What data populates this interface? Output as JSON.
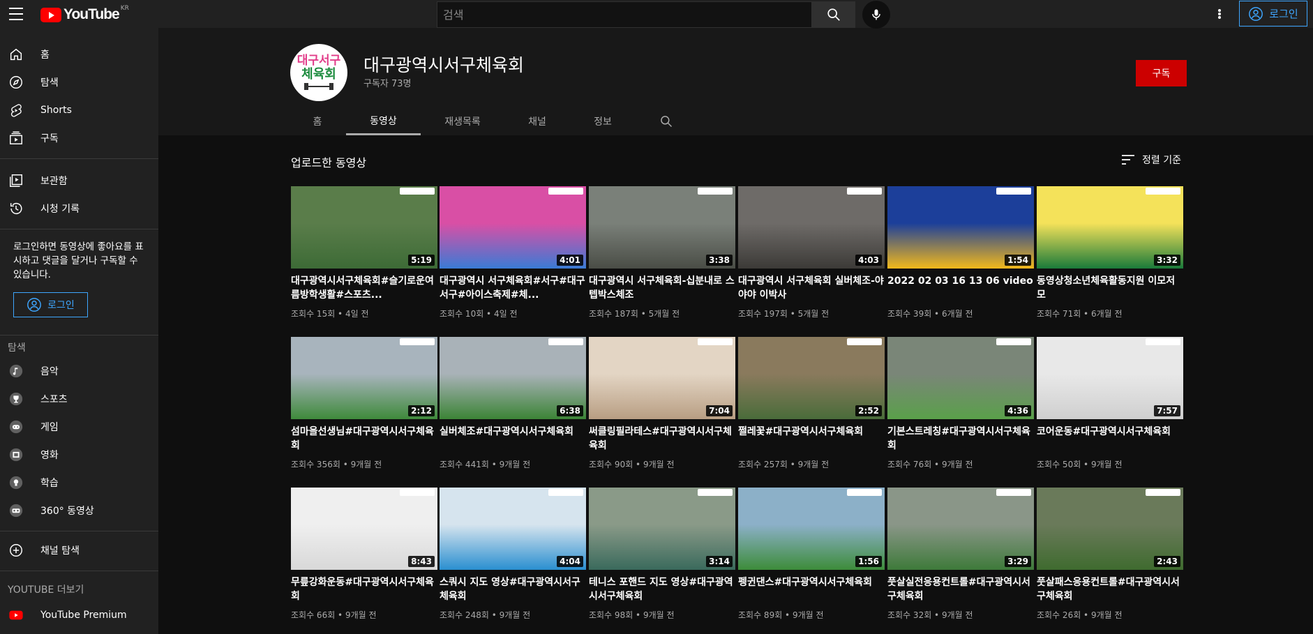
{
  "header": {
    "logo_text": "YouTube",
    "region": "KR",
    "search_placeholder": "검색",
    "login_label": "로그인"
  },
  "sidebar": {
    "main": [
      {
        "label": "홈",
        "icon": "home-icon"
      },
      {
        "label": "탐색",
        "icon": "compass-icon"
      },
      {
        "label": "Shorts",
        "icon": "shorts-icon"
      },
      {
        "label": "구독",
        "icon": "subscriptions-icon"
      }
    ],
    "library": [
      {
        "label": "보관함",
        "icon": "library-icon"
      },
      {
        "label": "시청 기록",
        "icon": "history-icon"
      }
    ],
    "login_prompt": "로그인하면 동영상에 좋아요를 표시하고 댓글을 달거나 구독할 수 있습니다.",
    "login_label": "로그인",
    "explore_title": "탐색",
    "explore": [
      {
        "label": "음악",
        "icon": "music-icon"
      },
      {
        "label": "스포츠",
        "icon": "trophy-icon"
      },
      {
        "label": "게임",
        "icon": "gamepad-icon"
      },
      {
        "label": "영화",
        "icon": "film-icon"
      },
      {
        "label": "학습",
        "icon": "lightbulb-icon"
      },
      {
        "label": "360° 동영상",
        "icon": "vr-icon"
      }
    ],
    "browse_channels": "채널 탐색",
    "more_title": "YOUTUBE 더보기",
    "premium": "YouTube Premium"
  },
  "channel": {
    "avatar_text_top": "대구서구",
    "avatar_text_bottom": "체육회",
    "name": "대구광역시서구체육회",
    "subscribers": "구독자 73명",
    "subscribe_label": "구독",
    "tabs": [
      "홈",
      "동영상",
      "재생목록",
      "채널",
      "정보"
    ],
    "active_tab": 1
  },
  "section": {
    "title": "업로드한 동영상",
    "sort_label": "정렬 기준"
  },
  "videos": [
    {
      "title": "대구광역시서구체육회#슬기로운여름방학생활#스포츠...",
      "meta": "조회수 15회 • 4일 전",
      "duration": "5:19",
      "colors": [
        "#5a7d4a",
        "#3d6b36"
      ]
    },
    {
      "title": "대구광역시 서구체육회#서구#대구서구#아이스축제#체...",
      "meta": "조회수 10회 • 4일 전",
      "duration": "4:01",
      "colors": [
        "#d94fa5",
        "#3a7bd5"
      ]
    },
    {
      "title": "대구광역시 서구체육회-십분내로 스텝박스체조",
      "meta": "조회수 187회 • 5개월 전",
      "duration": "3:38",
      "colors": [
        "#7a8079",
        "#4a4d46"
      ]
    },
    {
      "title": "대구광역시 서구체육회 실버체조-야야야 이박사",
      "meta": "조회수 197회 • 5개월 전",
      "duration": "4:03",
      "colors": [
        "#6e6b68",
        "#3c3a37"
      ]
    },
    {
      "title": "2022 02 03 16 13 06 video",
      "meta": "조회수 39회 • 6개월 전",
      "duration": "1:54",
      "colors": [
        "#1c3f9a",
        "#f3b91b"
      ]
    },
    {
      "title": "동영상청소년체육활동지원 이모저모",
      "meta": "조회수 71회 • 6개월 전",
      "duration": "3:32",
      "colors": [
        "#f4e25a",
        "#1a7a3a"
      ]
    },
    {
      "title": "섬마을선생님#대구광역시서구체육회",
      "meta": "조회수 356회 • 9개월 전",
      "duration": "2:12",
      "colors": [
        "#a8b4bd",
        "#3f8a3b"
      ]
    },
    {
      "title": "실버체조#대구광역시서구체육회",
      "meta": "조회수 441회 • 9개월 전",
      "duration": "6:38",
      "colors": [
        "#a9b2b8",
        "#3c8436"
      ]
    },
    {
      "title": "써클링필라테스#대구광역시서구체육회",
      "meta": "조회수 90회 • 9개월 전",
      "duration": "7:04",
      "colors": [
        "#e3d5c4",
        "#b89e83"
      ]
    },
    {
      "title": "쩔레꽃#대구광역시서구체육회",
      "meta": "조회수 257회 • 9개월 전",
      "duration": "2:52",
      "colors": [
        "#8a7a5d",
        "#4a6c3a"
      ]
    },
    {
      "title": "기본스트레칭#대구광역시서구체육회",
      "meta": "조회수 76회 • 9개월 전",
      "duration": "4:36",
      "colors": [
        "#7a8678",
        "#5aa04a"
      ]
    },
    {
      "title": "코어운동#대구광역시서구체육회",
      "meta": "조회수 50회 • 9개월 전",
      "duration": "7:57",
      "colors": [
        "#e8e8e8",
        "#cfcfcf"
      ]
    },
    {
      "title": "무릎강화운동#대구광역시서구체육회",
      "meta": "조회수 66회 • 9개월 전",
      "duration": "8:43",
      "colors": [
        "#efefef",
        "#d8d8d8"
      ]
    },
    {
      "title": "스쿼시 지도 영상#대구광역시서구체육회",
      "meta": "조회수 248회 • 9개월 전",
      "duration": "4:04",
      "colors": [
        "#d6e4ee",
        "#2a8fd0"
      ]
    },
    {
      "title": "테니스 포핸드 지도 영상#대구광역시서구체육회",
      "meta": "조회수 98회 • 9개월 전",
      "duration": "3:14",
      "colors": [
        "#8a9a88",
        "#3a6a5c"
      ]
    },
    {
      "title": "펭귄댄스#대구광역시서구체육회",
      "meta": "조회수 89회 • 9개월 전",
      "duration": "1:56",
      "colors": [
        "#8cb0c8",
        "#3d8c3a"
      ]
    },
    {
      "title": "풋살실전응용컨트롤#대구광역시서구체육회",
      "meta": "조회수 32회 • 9개월 전",
      "duration": "3:29",
      "colors": [
        "#8a9688",
        "#3e7a3a"
      ]
    },
    {
      "title": "풋살패스응용컨트롤#대구광역시서구체육회",
      "meta": "조회수 26회 • 9개월 전",
      "duration": "2:43",
      "colors": [
        "#6a7a5a",
        "#3f6b2f"
      ]
    }
  ]
}
